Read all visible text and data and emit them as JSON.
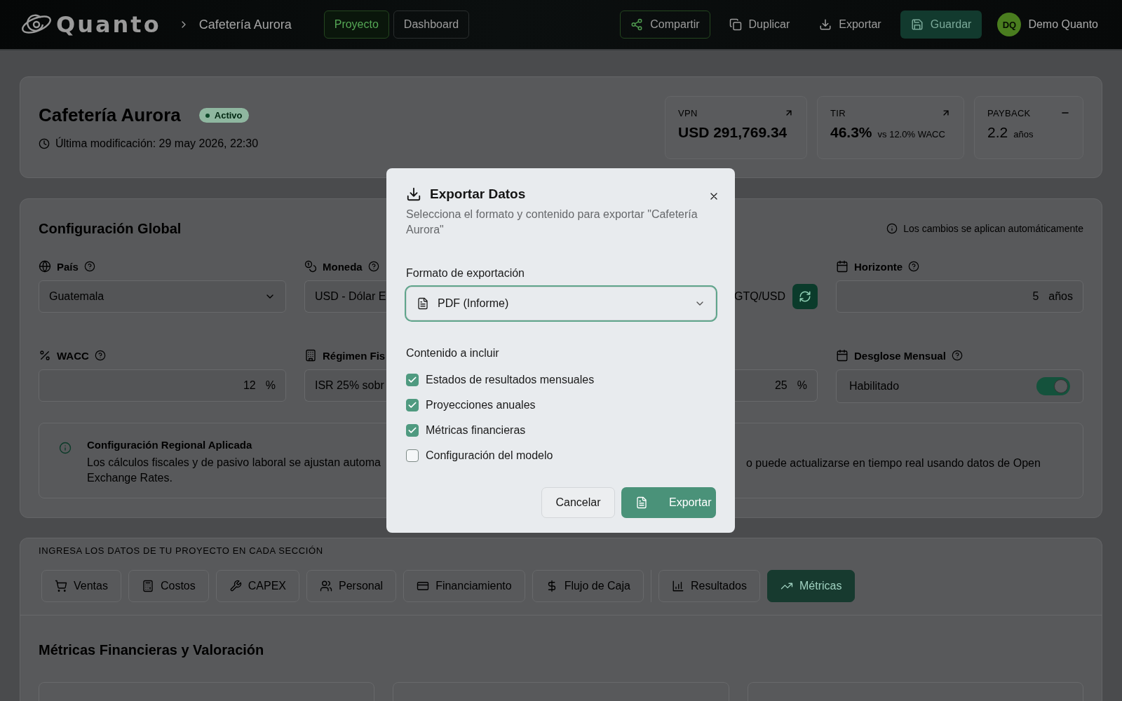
{
  "header": {
    "logo": "Quanto",
    "breadcrumb": "Cafetería Aurora",
    "nav": [
      {
        "label": "Proyecto",
        "selected": true
      },
      {
        "label": "Dashboard",
        "selected": false
      }
    ],
    "actions": [
      {
        "label": "Compartir",
        "kind": "outlined"
      },
      {
        "label": "Duplicar",
        "kind": "plain"
      },
      {
        "label": "Exportar",
        "kind": "plain"
      },
      {
        "label": "Guardar",
        "kind": "filled"
      }
    ],
    "user": {
      "initials": "DQ",
      "name": "Demo Quanto"
    }
  },
  "project": {
    "title": "Cafetería Aurora",
    "status": "Activo",
    "modified": "Última modificación: 29 may 2026, 22:30",
    "metrics": [
      {
        "label": "VPN",
        "value": "USD 291,769.34"
      },
      {
        "label": "TIR",
        "value": "46.3%",
        "note": "vs 12.0% WACC"
      },
      {
        "label": "PAYBACK",
        "value": "2.2",
        "note": "años"
      }
    ]
  },
  "config": {
    "title": "Configuración Global",
    "note": "Los cambios se aplican automáticamente",
    "fields": [
      {
        "kind": "select",
        "label": "País",
        "help": true,
        "value": "Guatemala"
      },
      {
        "kind": "text",
        "label": "Moneda",
        "help": true,
        "value": "USD - Dólar E"
      },
      {
        "kind": "rate",
        "unit": "GTQ/USD"
      },
      {
        "kind": "number",
        "label": "Horizonte",
        "help": true,
        "value": "5",
        "unit": "años"
      },
      {
        "kind": "number",
        "label": "WACC",
        "help": true,
        "value": "12",
        "unit": "%"
      },
      {
        "kind": "text",
        "label": "Régimen Fis",
        "value": "ISR 25% sobr"
      },
      {
        "kind": "number",
        "value": "25",
        "unit": "%"
      },
      {
        "kind": "toggle",
        "label": "Desglose Mensual",
        "help": true,
        "value": "Habilitado",
        "on": true
      }
    ],
    "info": {
      "title": "Configuración Regional Aplicada",
      "lines_left": [
        "Los cálculos fiscales y de pasivo laboral se ajustan automa",
        "Exchange Rates."
      ],
      "lines_right": [
        "o puede actualizarse en tiempo real usando datos de Open"
      ]
    }
  },
  "sections": {
    "heading": "INGRESA LOS DATOS DE TU PROYECTO EN CADA SECCIÓN",
    "tab_groups": [
      [
        {
          "label": "Ventas",
          "selected": false
        },
        {
          "label": "Costos",
          "selected": false
        },
        {
          "label": "CAPEX",
          "selected": false
        },
        {
          "label": "Personal",
          "selected": false
        },
        {
          "label": "Financiamiento",
          "selected": false
        },
        {
          "label": "Flujo de Caja",
          "selected": false
        }
      ],
      [
        {
          "label": "Resultados",
          "selected": false
        },
        {
          "label": "Métricas",
          "selected": true
        }
      ]
    ],
    "title": "Métricas Financieras y Valoración"
  },
  "dialog": {
    "title": "Exportar Datos",
    "description": "Selecciona el formato y contenido para exportar \"Cafetería Aurora\"",
    "format_label": "Formato de exportación",
    "format": "PDF (Informe)",
    "content_label": "Contenido a incluir",
    "options": [
      {
        "label": "Estados de resultados mensuales",
        "checked": true
      },
      {
        "label": "Proyecciones anuales",
        "checked": true
      },
      {
        "label": "Métricas financieras",
        "checked": true
      },
      {
        "label": "Configuración del modelo",
        "checked": false
      }
    ],
    "buttons": [
      {
        "label": "Cancelar",
        "kind": "secondary"
      },
      {
        "label": "Exportar",
        "kind": "primary"
      }
    ]
  }
}
